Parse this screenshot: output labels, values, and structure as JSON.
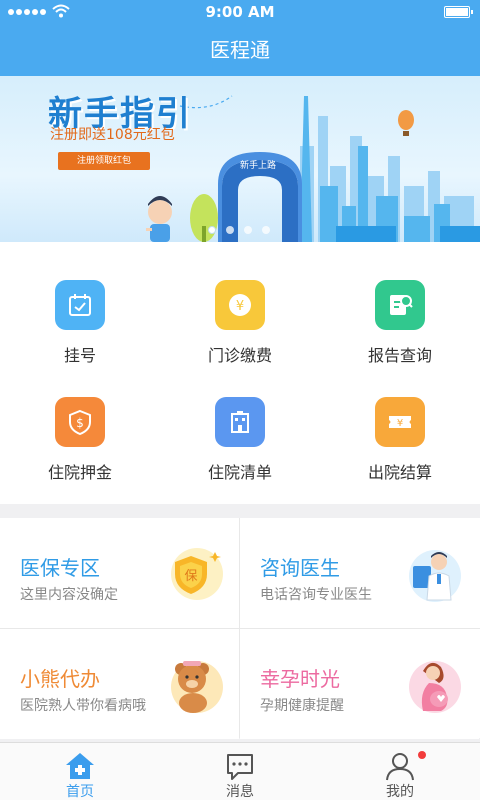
{
  "status_bar": {
    "time": "9:00 AM"
  },
  "header": {
    "title": "医程通"
  },
  "banner": {
    "title": "新手指引",
    "subtitle": "注册即送108元红包",
    "button_label": "注册领取红包",
    "gate_label": "新手上路",
    "page_count": 4,
    "active_page": 1
  },
  "grid": [
    {
      "label": "挂号",
      "icon": "calendar-check-icon",
      "color": "#4fb3f5"
    },
    {
      "label": "门诊缴费",
      "icon": "yen-coin-icon",
      "color": "#f8c83a"
    },
    {
      "label": "报告查询",
      "icon": "report-search-icon",
      "color": "#31c88e"
    },
    {
      "label": "住院押金",
      "icon": "yen-shield-icon",
      "color": "#f5893a"
    },
    {
      "label": "住院清单",
      "icon": "hospital-building-icon",
      "color": "#5b97f0"
    },
    {
      "label": "出院结算",
      "icon": "yen-ticket-icon",
      "color": "#f8a83a"
    }
  ],
  "cards": [
    {
      "title": "医保专区",
      "desc": "这里内容没确定",
      "title_color": "#2f9be6",
      "art": "insurance-shield-icon"
    },
    {
      "title": "咨询医生",
      "desc": "电话咨询专业医生",
      "title_color": "#2f9be6",
      "art": "doctor-icon"
    },
    {
      "title": "小熊代办",
      "desc": "医院熟人带你看病哦",
      "title_color": "#ef8a35",
      "art": "bear-icon"
    },
    {
      "title": "幸孕时光",
      "desc": "孕期健康提醒",
      "title_color": "#ec6aa0",
      "art": "pregnant-woman-icon"
    }
  ],
  "tabbar": [
    {
      "label": "首页",
      "icon": "home-icon",
      "active": true
    },
    {
      "label": "消息",
      "icon": "message-icon",
      "active": false
    },
    {
      "label": "我的",
      "icon": "profile-icon",
      "active": false,
      "badge": true
    }
  ],
  "colors": {
    "primary": "#4aaaf0",
    "accent": "#3b9ded"
  }
}
